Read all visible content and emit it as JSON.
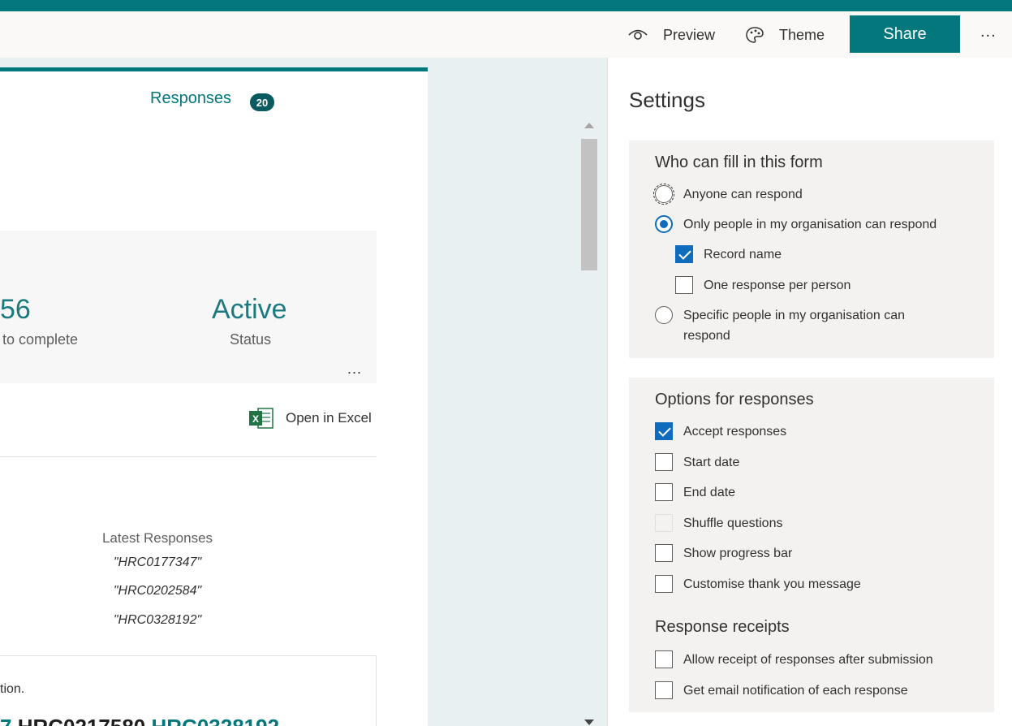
{
  "toolbar": {
    "preview_label": "Preview",
    "theme_label": "Theme",
    "share_label": "Share",
    "more_label": "..."
  },
  "responses_panel": {
    "tab_label": "Responses",
    "response_count": "20",
    "stats": [
      {
        "value": "56",
        "label": "to complete"
      },
      {
        "value": "Active",
        "label": "Status"
      }
    ],
    "more_label": "...",
    "open_in_excel_label": "Open in Excel",
    "latest_title": "Latest Responses",
    "latest_items": [
      "\"HRC0177347\"",
      "\"HRC0202584\"",
      "\"HRC0328192\""
    ],
    "question_text_fragment": "tion.",
    "id_fragments": {
      "teal_fragment": "7",
      "dark_id": "HRC0217580",
      "teal_id": "HRC0328192"
    }
  },
  "settings": {
    "title": "Settings",
    "who_can_fill": {
      "title": "Who can fill in this form",
      "options": [
        {
          "label": "Anyone can respond",
          "selected": false
        },
        {
          "label": "Only people in my organisation can respond",
          "selected": true
        },
        {
          "label": "Specific people in my organisation can respond",
          "selected": false
        }
      ],
      "sub_options": [
        {
          "label": "Record name",
          "checked": true
        },
        {
          "label": "One response per person",
          "checked": false
        }
      ]
    },
    "response_options": {
      "title": "Options for responses",
      "items": [
        {
          "label": "Accept responses",
          "checked": true
        },
        {
          "label": "Start date",
          "checked": false
        },
        {
          "label": "End date",
          "checked": false
        },
        {
          "label": "Shuffle questions",
          "checked": false,
          "disabled": true
        },
        {
          "label": "Show progress bar",
          "checked": false
        },
        {
          "label": "Customise thank you message",
          "checked": false
        }
      ]
    },
    "response_receipts": {
      "title": "Response receipts",
      "items": [
        {
          "label": "Allow receipt of responses after submission",
          "checked": false
        },
        {
          "label": "Get email notification of each response",
          "checked": false
        }
      ]
    }
  },
  "colors": {
    "brand": "#03787c",
    "accent_blue": "#0f6cbd"
  },
  "icons": {
    "preview": "eye-icon",
    "theme": "palette-icon",
    "excel": "excel-icon"
  }
}
